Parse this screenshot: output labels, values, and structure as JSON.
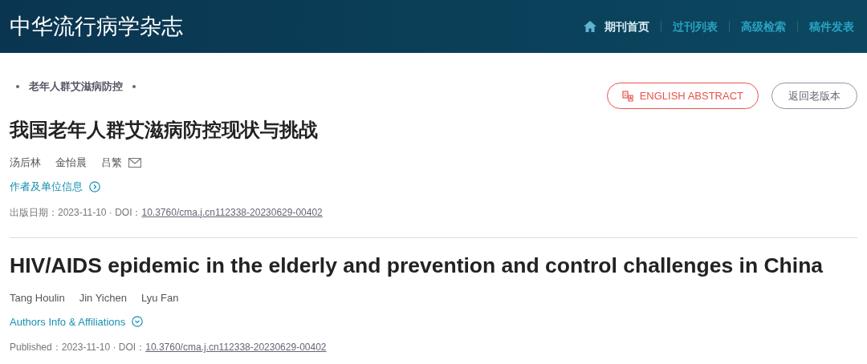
{
  "header": {
    "title": "中华流行病学杂志",
    "nav": [
      {
        "label": "期刊首页",
        "selected": true
      },
      {
        "label": "过刊列表",
        "selected": false
      },
      {
        "label": "高级检索",
        "selected": false
      },
      {
        "label": "稿件发表",
        "selected": false
      }
    ]
  },
  "category": "老年人群艾滋病防控",
  "buttons": [
    {
      "label": "ENGLISH ABSTRACT",
      "kind": "primary"
    },
    {
      "label": "返回老版本",
      "kind": "secondary"
    }
  ],
  "sections": [
    {
      "title": "我国老年人群艾滋病防控现状与挑战",
      "authors": [
        "汤后林",
        "金怡晨",
        "吕繁"
      ],
      "email": true,
      "affiliations": {
        "label": "作者及单位信息",
        "kind": "arrow-right"
      },
      "date_label": "出版日期：2023-11-10 · DOI：",
      "doi": "10.3760/cma.j.cn112338-20230629-00402"
    },
    {
      "title": "HIV/AIDS epidemic in the elderly and prevention and control challenges in China",
      "authors": [
        "Tang Houlin",
        "Jin Yichen",
        "Lyu Fan"
      ],
      "email": false,
      "affiliations": {
        "label": "Authors Info & Affiliations",
        "kind": "arrow-down"
      },
      "date_label": "Published：2023-11-10 · DOI：",
      "doi": "10.3760/cma.j.cn112338-20230629-00402"
    }
  ]
}
